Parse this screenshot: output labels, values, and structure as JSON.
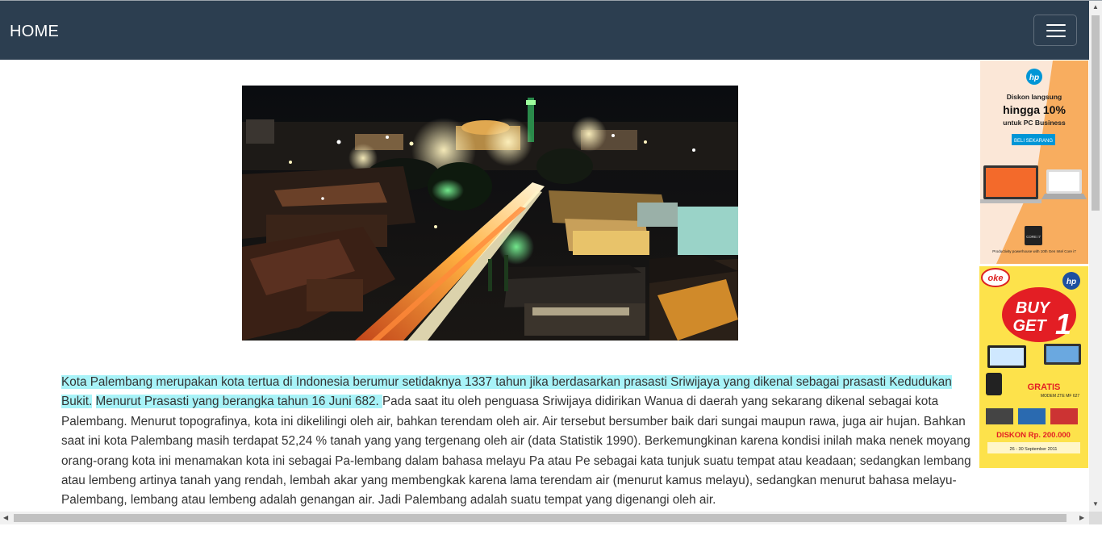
{
  "navbar": {
    "brand": "HOME",
    "toggle_icon": "hamburger-menu-icon",
    "background": "#2c3e50"
  },
  "hero_image": {
    "subject": "night-city-skyline-photo"
  },
  "article": {
    "highlighted_line1": " Kota Palembang merupakan kota tertua di Indonesia berumur setidaknya 1337 tahun jika berdasarkan prasasti Sriwijaya yang dikenal sebagai prasasti Kedudukan Bukit.",
    "highlighted_line2": "Menurut Prasasti yang berangka tahun 16 Juni 682. ",
    "rest": "Pada saat itu oleh penguasa Sriwijaya didirikan Wanua di daerah yang sekarang dikenal sebagai kota Palembang. Menurut topografinya, kota ini dikelilingi oleh air, bahkan terendam oleh air. Air tersebut bersumber baik dari sungai maupun rawa, juga air hujan. Bahkan saat ini kota Palembang masih terdapat 52,24 % tanah yang yang tergenang oleh air (data Statistik 1990). Berkemungkinan karena kondisi inilah maka nenek moyang orang-orang kota ini menamakan kota ini sebagai Pa-lembang dalam bahasa melayu Pa atau Pe sebagai kata tunjuk suatu tempat atau keadaan; sedangkan lembang atau lembeng artinya tanah yang rendah, lembah akar yang membengkak karena lama terendam air (menurut kamus melayu), sedangkan menurut bahasa melayu-Palembang, lembang atau lembeng adalah genangan air. Jadi Palembang adalah suatu tempat yang digenangi oleh air.",
    "highlight_color": "#a8f3f8"
  },
  "ads": {
    "ad1": {
      "logo": "hp",
      "line1": "Diskon langsung",
      "line2": "hingga 10%",
      "line3": "untuk PC Business",
      "button": "BELI SEKARANG",
      "caption": "Productivity powerhouse with 10th Gen Intel Core i7",
      "badge": "CORE i7"
    },
    "ad2": {
      "brand_badge": "oke",
      "logo": "hp",
      "promo_line1": "BUY",
      "promo_line2": "GET",
      "promo_number": "1",
      "gratis_label": "GRATIS",
      "gratis_sub": "MODEM ZTE MF 627",
      "discount": "DISKON Rp. 200.000",
      "period": "26 - 30 September 2011"
    }
  }
}
